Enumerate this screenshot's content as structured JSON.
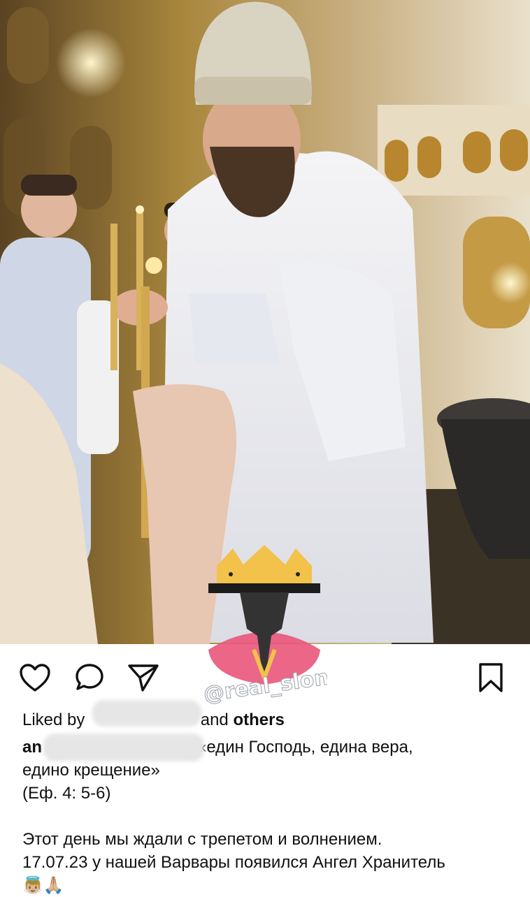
{
  "post": {
    "liked_by_prefix": "Liked by",
    "liked_by_suffix_and": "and",
    "liked_by_others": "others",
    "username_visible": "an",
    "caption_line1_tail": "«един Господь, едина вера,",
    "caption_line2": "едино крещение»",
    "caption_line3": "(Еф. 4: 5-6)",
    "caption_line4": "Этот день мы ждали с трепетом и волнением.",
    "caption_line5": "17.07.23 у нашей Варвары появился Ангел Хранитель",
    "caption_emoji": "👼🏼🙏🏼"
  },
  "watermark": {
    "text": "@real_slon"
  },
  "icons": {
    "like": "heart-icon",
    "comment": "comment-bubble-icon",
    "share": "paper-plane-icon",
    "save": "bookmark-icon"
  },
  "colors": {
    "watermark_crown": "#f2c24b",
    "watermark_pink": "#e9557a",
    "text": "#111111",
    "blur": "#e6e6e6"
  }
}
